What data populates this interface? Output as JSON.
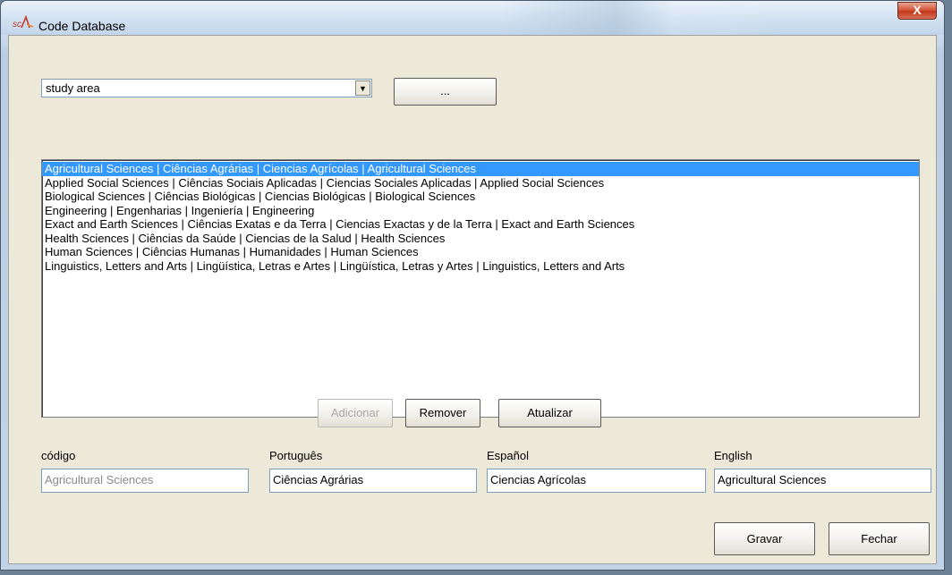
{
  "window": {
    "title": "Code Database",
    "close_glyph": "X"
  },
  "selector": {
    "value": "study area",
    "arrow_glyph": "▼",
    "browse_label": "..."
  },
  "list": {
    "items": [
      "Agricultural Sciences | Ciências Agrárias | Ciencias Agrícolas | Agricultural Sciences",
      "Applied Social Sciences | Ciências Sociais Aplicadas | Ciencias Sociales Aplicadas | Applied Social Sciences",
      "Biological Sciences | Ciências Biológicas | Ciencias Biológicas | Biological Sciences",
      "Engineering | Engenharias | Ingeniería | Engineering",
      "Exact and Earth Sciences | Ciências Exatas e da Terra | Ciencias Exactas y de la Terra | Exact and Earth Sciences",
      "Health Sciences | Ciências da Saúde | Ciencias de la Salud | Health Sciences",
      "Human Sciences | Ciências Humanas | Humanidades | Human Sciences",
      "Linguistics, Letters and Arts | Lingüística, Letras e Artes | Lingüística, Letras y Artes | Linguistics, Letters and Arts"
    ],
    "selected_index": 0
  },
  "actions": {
    "add_label": "Adicionar",
    "remove_label": "Remover",
    "update_label": "Atualizar"
  },
  "fields": {
    "code": {
      "label": "código",
      "value": "Agricultural Sciences"
    },
    "portuguese": {
      "label": "Português",
      "value": "Ciências Agrárias"
    },
    "spanish": {
      "label": "Español",
      "value": "Ciencias Agrícolas"
    },
    "english": {
      "label": "English",
      "value": "Agricultural Sciences"
    }
  },
  "footer": {
    "save_label": "Gravar",
    "close_label": "Fechar"
  },
  "colors": {
    "selection": "#3399ff",
    "dialog_bg": "#ece9d8"
  }
}
